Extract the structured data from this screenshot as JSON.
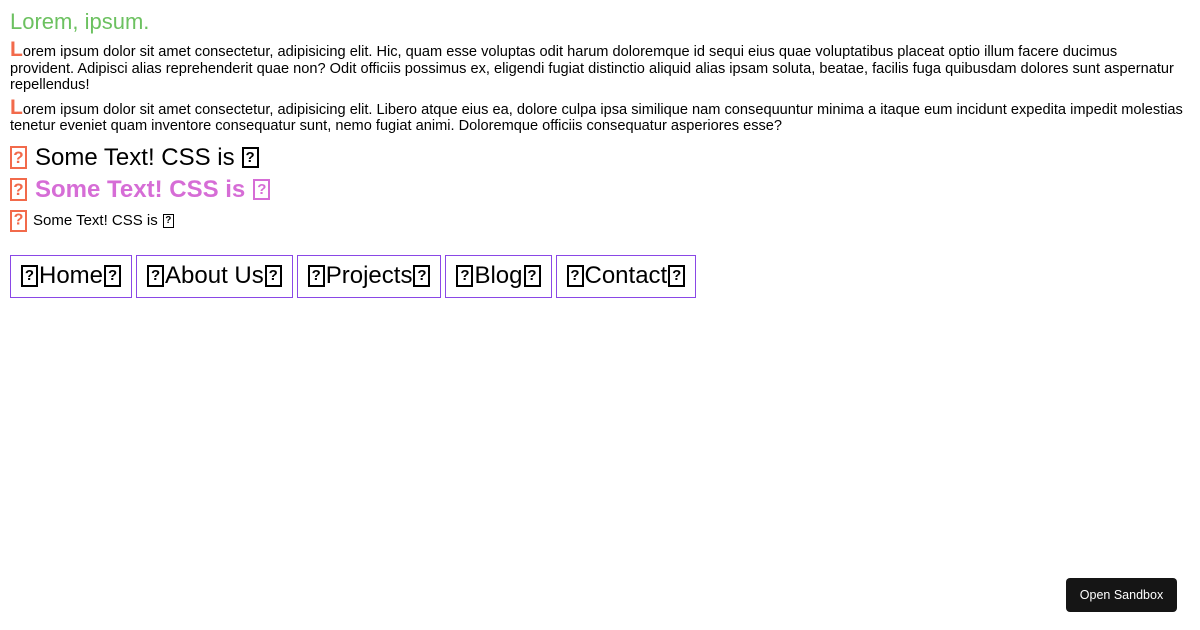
{
  "heading": "Lorem, ipsum.",
  "paragraphs": [
    {
      "dropcap": "L",
      "rest": "orem ipsum dolor sit amet consectetur, adipisicing elit. Hic, quam esse voluptas odit harum doloremque id sequi eius quae voluptatibus placeat optio illum facere ducimus provident. Adipisci alias reprehenderit quae non? Odit officiis possimus ex, eligendi fugiat distinctio aliquid alias ipsam soluta, beatae, facilis fuga quibusdam dolores sunt aspernatur repellendus!"
    },
    {
      "dropcap": "L",
      "rest": "orem ipsum dolor sit amet consectetur, adipisicing elit. Libero atque eius ea, dolore culpa ipsa similique nam consequuntur minima a itaque eum incidunt expedita impedit molestias tenetur eveniet quam inventore consequatur sunt, nemo fugiat animi. Doloremque officiis consequatur asperiores esse?"
    }
  ],
  "tag_lines": [
    {
      "text": "Some Text! CSS is"
    },
    {
      "text": "Some Text! CSS is"
    },
    {
      "text": "Some Text! CSS is"
    }
  ],
  "nav": {
    "items": [
      {
        "label": "Home"
      },
      {
        "label": "About Us"
      },
      {
        "label": "Projects"
      },
      {
        "label": "Blog"
      },
      {
        "label": "Contact"
      }
    ]
  },
  "sandbox_button": {
    "label": "Open Sandbox"
  },
  "colors": {
    "heading": "#6cc160",
    "dropcap": "#f26a4b",
    "bold_line": "#d66dd6",
    "nav_border": "#8a48e6",
    "button_bg": "#151515"
  },
  "icons": {
    "missing_glyph": "missing-glyph-icon"
  }
}
